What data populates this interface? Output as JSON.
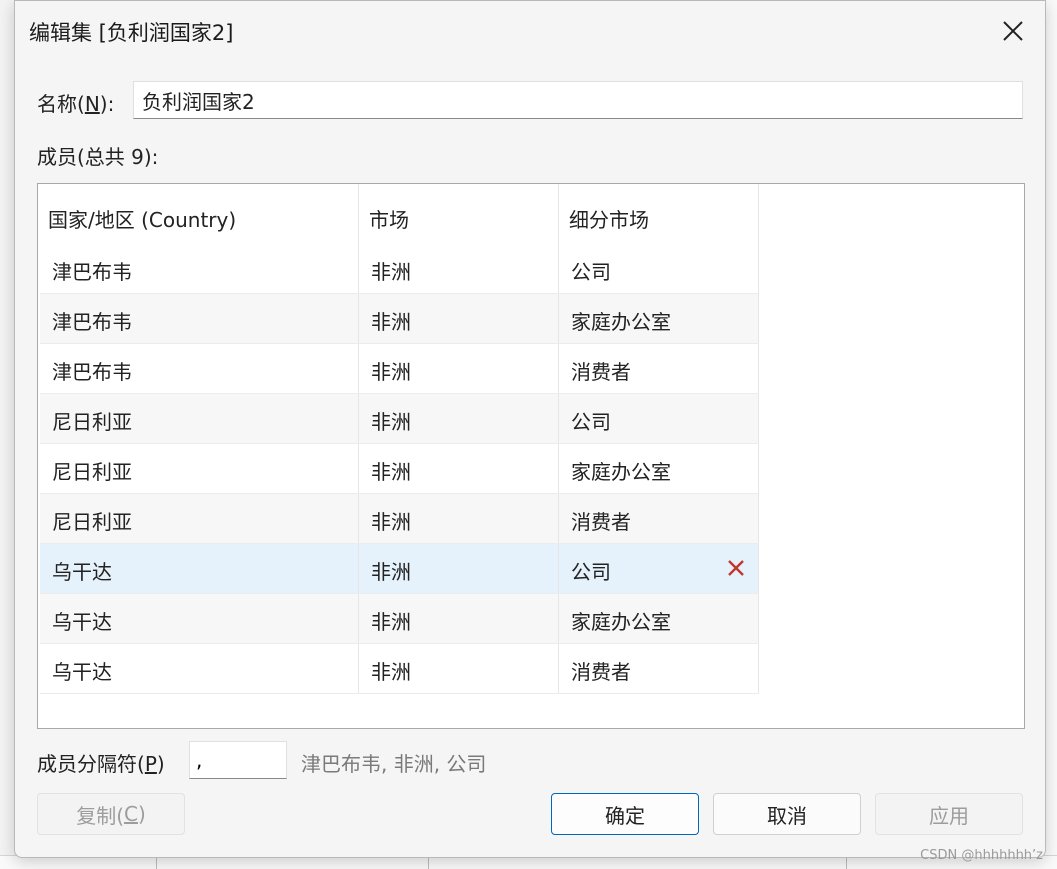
{
  "dialog": {
    "title": "编辑集 [负利润国家2]"
  },
  "name_field": {
    "label_prefix": "名称(",
    "label_key": "N",
    "label_suffix": "):",
    "value": "负利润国家2"
  },
  "members": {
    "label": "成员(总共 9):",
    "columns": [
      "国家/地区 (Country)",
      "市场",
      "细分市场"
    ],
    "rows": [
      [
        "津巴布韦",
        "非洲",
        "公司"
      ],
      [
        "津巴布韦",
        "非洲",
        "家庭办公室"
      ],
      [
        "津巴布韦",
        "非洲",
        "消费者"
      ],
      [
        "尼日利亚",
        "非洲",
        "公司"
      ],
      [
        "尼日利亚",
        "非洲",
        "家庭办公室"
      ],
      [
        "尼日利亚",
        "非洲",
        "消费者"
      ],
      [
        "乌干达",
        "非洲",
        "公司"
      ],
      [
        "乌干达",
        "非洲",
        "家庭办公室"
      ],
      [
        "乌干达",
        "非洲",
        "消费者"
      ]
    ],
    "selected_row": 6,
    "remove_icon": "close-x-icon",
    "remove_color": "#c0392b"
  },
  "separator": {
    "label_prefix": "成员分隔符(",
    "label_key": "P",
    "label_suffix": ")",
    "value": ",",
    "preview": "津巴布韦, 非洲, 公司"
  },
  "buttons": {
    "copy_prefix": "复制(",
    "copy_key": "C",
    "copy_suffix": ")",
    "ok": "确定",
    "cancel": "取消",
    "apply": "应用"
  },
  "watermark": "CSDN @hhhhhhh’z"
}
